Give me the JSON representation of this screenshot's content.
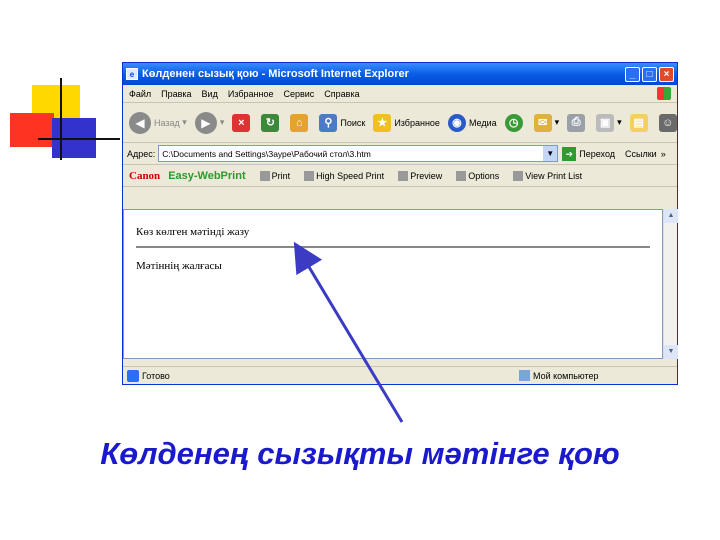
{
  "window": {
    "title": "Көлденен сызық қою - Microsoft Internet Explorer",
    "controls": [
      "_",
      "□",
      "×"
    ]
  },
  "menu": [
    "Файл",
    "Правка",
    "Вид",
    "Избранное",
    "Сервис",
    "Справка"
  ],
  "toolbar": {
    "back": "Назад",
    "search": "Поиск",
    "favorites": "Избранное",
    "media": "Медиа"
  },
  "address": {
    "label": "Адрес:",
    "value": "C:\\Documents and Settings\\Зауре\\Рабочий стол\\3.htm",
    "go": "Переход",
    "links": "Ссылки",
    "more": "»"
  },
  "canon_bar": {
    "brand": "Canon",
    "product": "Easy-WebPrint",
    "buttons": [
      "Print",
      "High Speed Print",
      "Preview",
      "Options",
      "View Print List"
    ]
  },
  "page": {
    "line1": "Көз көлген мәтінді жазу",
    "line2": "Мәтіннің жалғасы"
  },
  "status": {
    "left": "Готово",
    "right": "Мой компьютер"
  },
  "caption": "Көлденең сызықты мәтінге қою",
  "colors": {
    "caption": "#1a1acc",
    "arrow": "#3b3bc4"
  }
}
